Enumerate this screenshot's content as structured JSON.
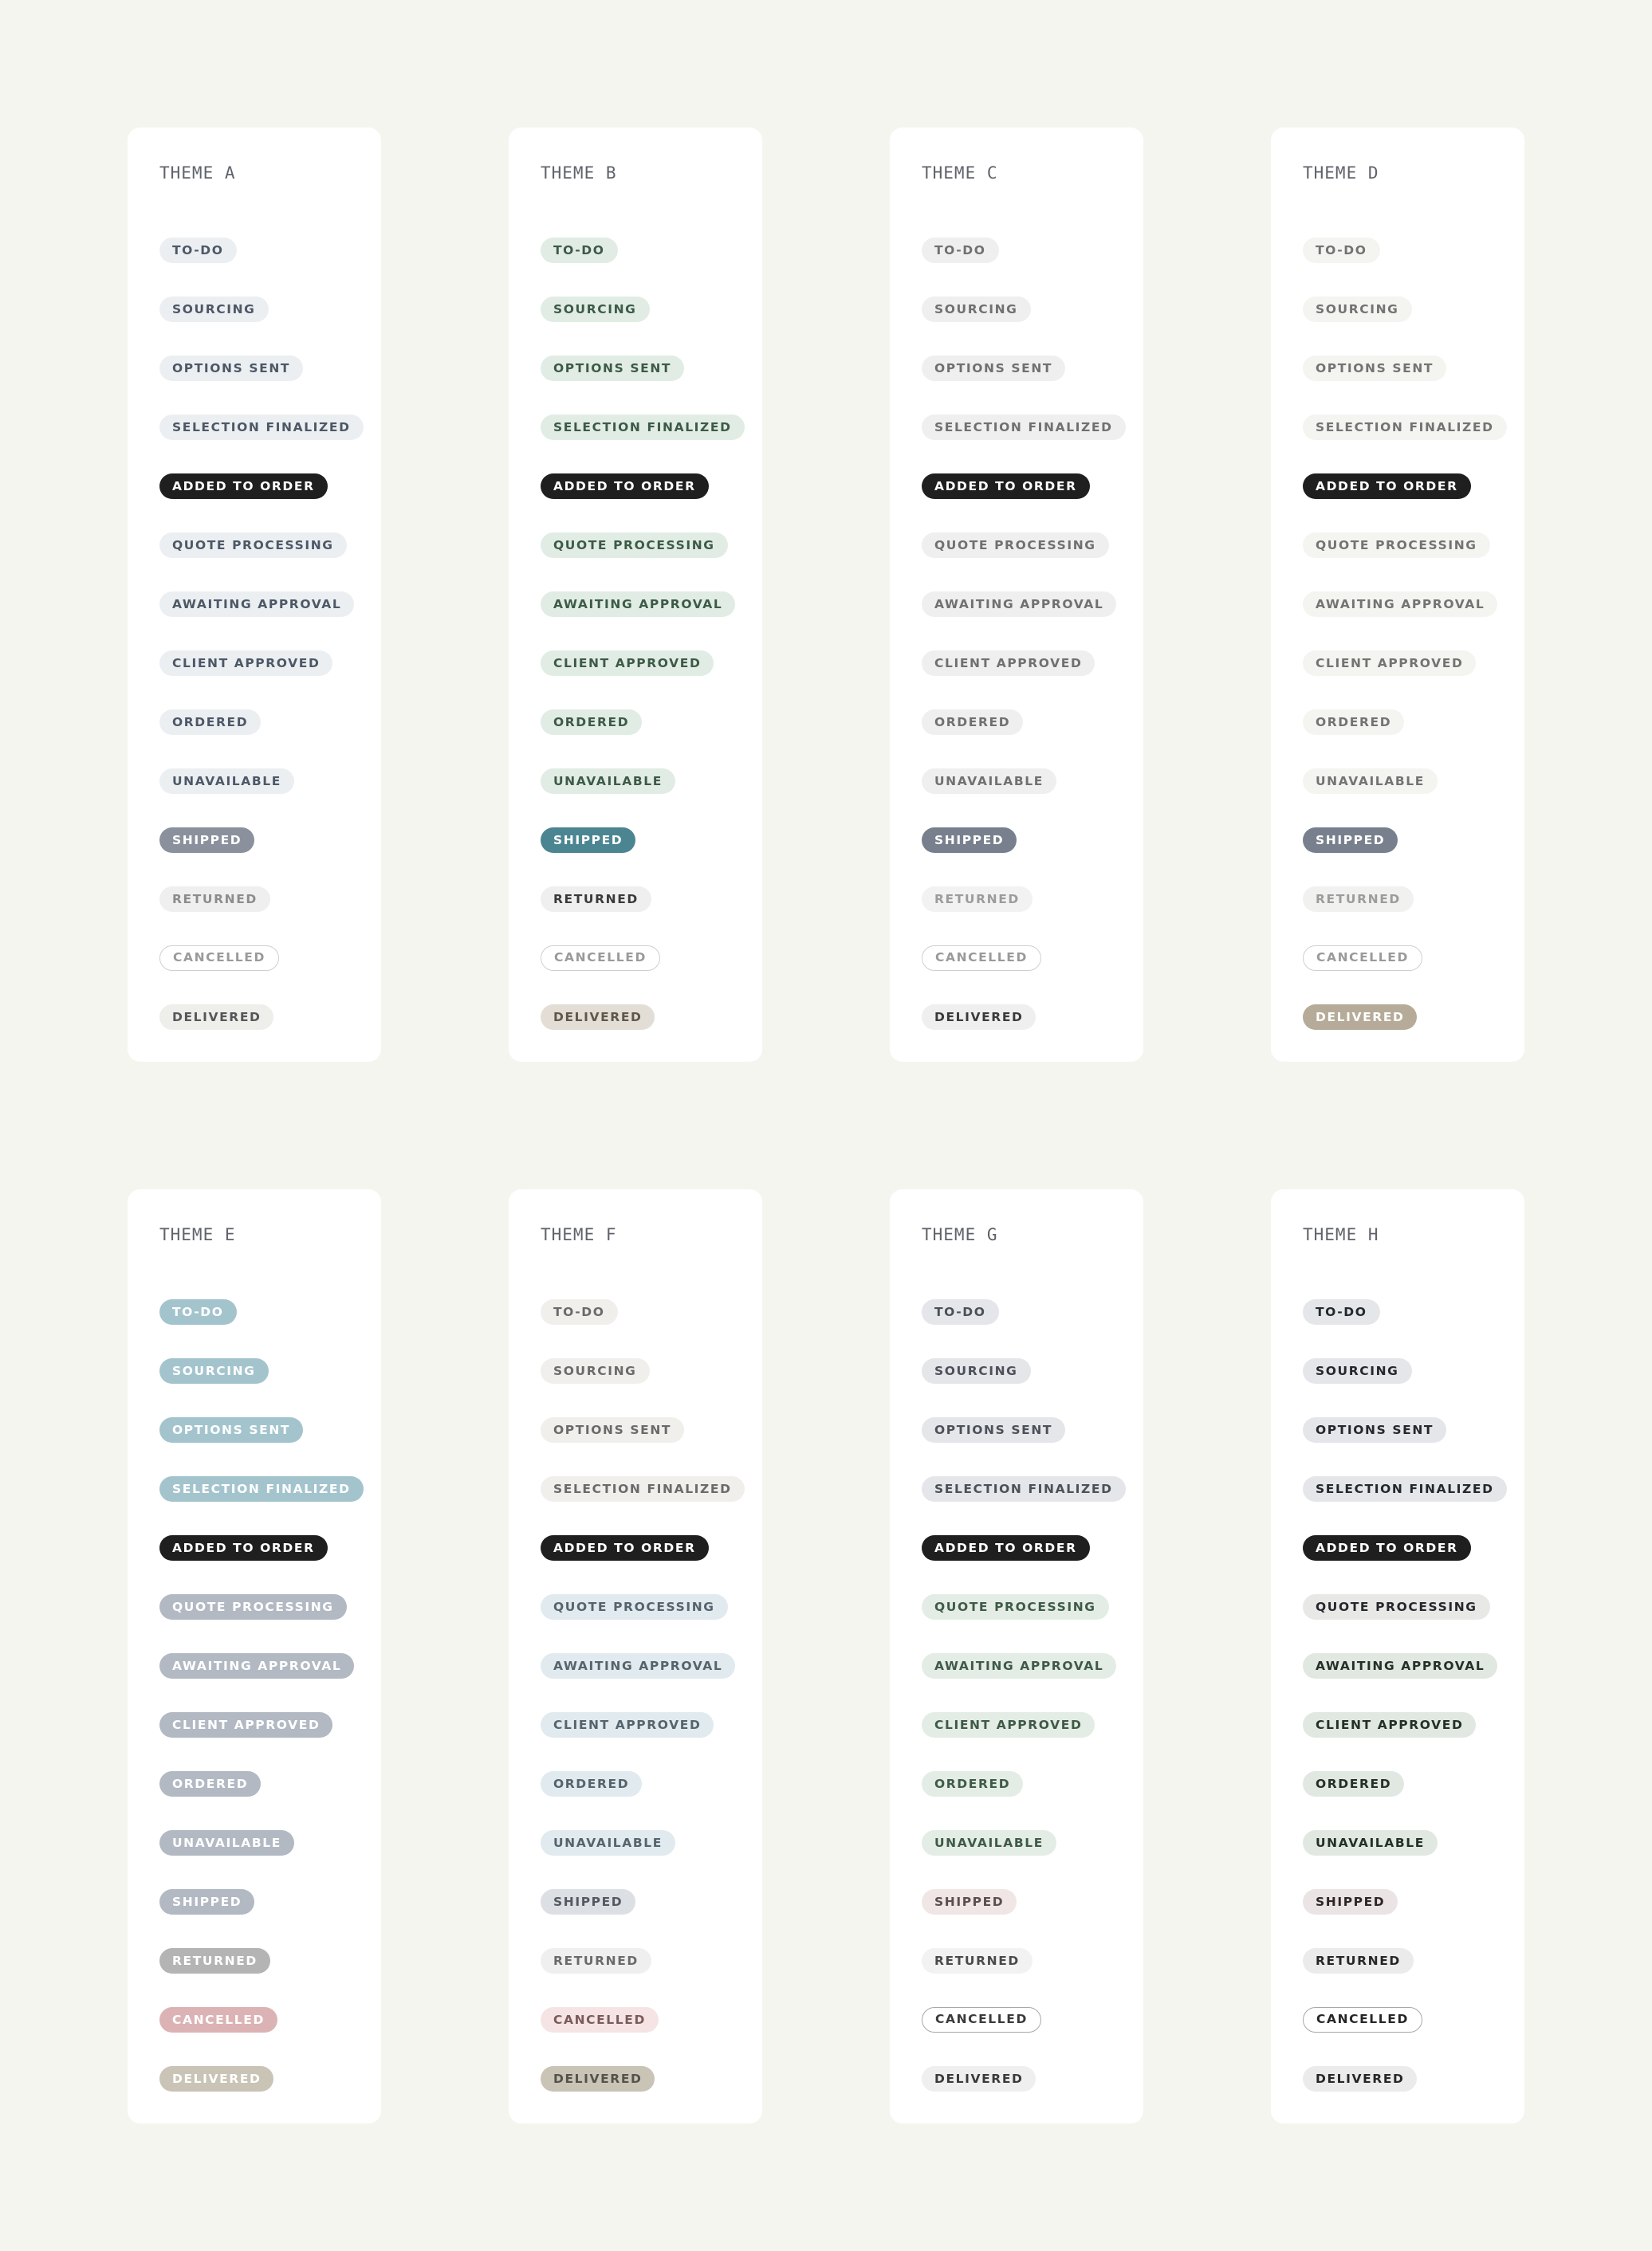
{
  "statuses": [
    "TO-DO",
    "SOURCING",
    "OPTIONS SENT",
    "SELECTION FINALIZED",
    "ADDED TO ORDER",
    "QUOTE PROCESSING",
    "AWAITING APPROVAL",
    "CLIENT APPROVED",
    "ORDERED",
    "UNAVAILABLE",
    "SHIPPED",
    "RETURNED",
    "CANCELLED",
    "DELIVERED"
  ],
  "themes": [
    {
      "title": "THEME A",
      "styles": [
        {
          "bg": "#eceff2",
          "color": "#4d5866",
          "border": "none"
        },
        {
          "bg": "#eceff2",
          "color": "#4d5866",
          "border": "none"
        },
        {
          "bg": "#eceff2",
          "color": "#4d5866",
          "border": "none"
        },
        {
          "bg": "#eceff2",
          "color": "#4d5866",
          "border": "none"
        },
        {
          "bg": "#1f1f1f",
          "color": "#ffffff",
          "border": "none"
        },
        {
          "bg": "#eceff2",
          "color": "#4d5866",
          "border": "none"
        },
        {
          "bg": "#eceff2",
          "color": "#4d5866",
          "border": "none"
        },
        {
          "bg": "#eceff2",
          "color": "#4d5866",
          "border": "none"
        },
        {
          "bg": "#eceff2",
          "color": "#4d5866",
          "border": "none"
        },
        {
          "bg": "#eceff2",
          "color": "#4d5866",
          "border": "none"
        },
        {
          "bg": "#8a919d",
          "color": "#ffffff",
          "border": "none"
        },
        {
          "bg": "#efefef",
          "color": "#8c8c8c",
          "border": "none"
        },
        {
          "bg": "#ffffff",
          "color": "#9a9a9a",
          "border": "1.5px solid #cfcfcf"
        },
        {
          "bg": "#eeeeea",
          "color": "#55555a",
          "border": "none"
        }
      ]
    },
    {
      "title": "THEME B",
      "styles": [
        {
          "bg": "#e1ede4",
          "color": "#3d5a47",
          "border": "none"
        },
        {
          "bg": "#e1ede4",
          "color": "#3d5a47",
          "border": "none"
        },
        {
          "bg": "#e1ede4",
          "color": "#3d5a47",
          "border": "none"
        },
        {
          "bg": "#e1ede4",
          "color": "#3d5a47",
          "border": "none"
        },
        {
          "bg": "#1f1f1f",
          "color": "#ffffff",
          "border": "none"
        },
        {
          "bg": "#e1ede4",
          "color": "#3d5a47",
          "border": "none"
        },
        {
          "bg": "#e1ede4",
          "color": "#3d5a47",
          "border": "none"
        },
        {
          "bg": "#e1ede4",
          "color": "#3d5a47",
          "border": "none"
        },
        {
          "bg": "#e1ede4",
          "color": "#3d5a47",
          "border": "none"
        },
        {
          "bg": "#e1ede4",
          "color": "#3d5a47",
          "border": "none"
        },
        {
          "bg": "#4c8592",
          "color": "#ffffff",
          "border": "none"
        },
        {
          "bg": "#efefef",
          "color": "#3a3a3a",
          "border": "none"
        },
        {
          "bg": "#ffffff",
          "color": "#9a9a9a",
          "border": "1.5px solid #cfcfcf"
        },
        {
          "bg": "#e2ded6",
          "color": "#5f574a",
          "border": "none"
        }
      ]
    },
    {
      "title": "THEME C",
      "styles": [
        {
          "bg": "#efefef",
          "color": "#707070",
          "border": "none"
        },
        {
          "bg": "#efefef",
          "color": "#707070",
          "border": "none"
        },
        {
          "bg": "#efefef",
          "color": "#707070",
          "border": "none"
        },
        {
          "bg": "#efefef",
          "color": "#707070",
          "border": "none"
        },
        {
          "bg": "#1f1f1f",
          "color": "#ffffff",
          "border": "none"
        },
        {
          "bg": "#efefef",
          "color": "#707070",
          "border": "none"
        },
        {
          "bg": "#efefef",
          "color": "#707070",
          "border": "none"
        },
        {
          "bg": "#efefef",
          "color": "#707070",
          "border": "none"
        },
        {
          "bg": "#efefef",
          "color": "#707070",
          "border": "none"
        },
        {
          "bg": "#efefef",
          "color": "#707070",
          "border": "none"
        },
        {
          "bg": "#79808d",
          "color": "#ffffff",
          "border": "none"
        },
        {
          "bg": "#f2f2f2",
          "color": "#9c9c9c",
          "border": "none"
        },
        {
          "bg": "#ffffff",
          "color": "#9a9a9a",
          "border": "1.5px solid #cfcfcf"
        },
        {
          "bg": "#efefef",
          "color": "#3a3a3a",
          "border": "none"
        }
      ]
    },
    {
      "title": "THEME D",
      "styles": [
        {
          "bg": "#f4f4f1",
          "color": "#737373",
          "border": "none"
        },
        {
          "bg": "#f4f4f1",
          "color": "#737373",
          "border": "none"
        },
        {
          "bg": "#f4f4f1",
          "color": "#737373",
          "border": "none"
        },
        {
          "bg": "#f4f4f1",
          "color": "#737373",
          "border": "none"
        },
        {
          "bg": "#1f1f1f",
          "color": "#ffffff",
          "border": "none"
        },
        {
          "bg": "#f4f4f1",
          "color": "#737373",
          "border": "none"
        },
        {
          "bg": "#f4f4f1",
          "color": "#737373",
          "border": "none"
        },
        {
          "bg": "#f4f4f1",
          "color": "#737373",
          "border": "none"
        },
        {
          "bg": "#f4f4f1",
          "color": "#737373",
          "border": "none"
        },
        {
          "bg": "#f4f4f1",
          "color": "#737373",
          "border": "none"
        },
        {
          "bg": "#79808d",
          "color": "#ffffff",
          "border": "none"
        },
        {
          "bg": "#f1f1ef",
          "color": "#9c9c9c",
          "border": "none"
        },
        {
          "bg": "#ffffff",
          "color": "#9a9a9a",
          "border": "1.5px solid #cfcfcf"
        },
        {
          "bg": "#b5ab98",
          "color": "#ffffff",
          "border": "none"
        }
      ]
    },
    {
      "title": "THEME E",
      "styles": [
        {
          "bg": "#a3c4cd",
          "color": "#ffffff",
          "border": "none"
        },
        {
          "bg": "#a3c4cd",
          "color": "#ffffff",
          "border": "none"
        },
        {
          "bg": "#a3c4cd",
          "color": "#ffffff",
          "border": "none"
        },
        {
          "bg": "#a3c4cd",
          "color": "#ffffff",
          "border": "none"
        },
        {
          "bg": "#1f1f1f",
          "color": "#ffffff",
          "border": "none"
        },
        {
          "bg": "#b2b9c3",
          "color": "#ffffff",
          "border": "none"
        },
        {
          "bg": "#b2b9c3",
          "color": "#ffffff",
          "border": "none"
        },
        {
          "bg": "#b2b9c3",
          "color": "#ffffff",
          "border": "none"
        },
        {
          "bg": "#b2b9c3",
          "color": "#ffffff",
          "border": "none"
        },
        {
          "bg": "#b2b9c3",
          "color": "#ffffff",
          "border": "none"
        },
        {
          "bg": "#b2b9c3",
          "color": "#ffffff",
          "border": "none"
        },
        {
          "bg": "#b4b4b4",
          "color": "#ffffff",
          "border": "none"
        },
        {
          "bg": "#dcb3b5",
          "color": "#ffffff",
          "border": "none"
        },
        {
          "bg": "#c9c4b6",
          "color": "#ffffff",
          "border": "none"
        }
      ]
    },
    {
      "title": "THEME F",
      "styles": [
        {
          "bg": "#f0efec",
          "color": "#6a6a6a",
          "border": "none"
        },
        {
          "bg": "#f0efec",
          "color": "#6a6a6a",
          "border": "none"
        },
        {
          "bg": "#f0efec",
          "color": "#6a6a6a",
          "border": "none"
        },
        {
          "bg": "#f0efec",
          "color": "#6a6a6a",
          "border": "none"
        },
        {
          "bg": "#1f1f1f",
          "color": "#ffffff",
          "border": "none"
        },
        {
          "bg": "#e1eaee",
          "color": "#55636c",
          "border": "none"
        },
        {
          "bg": "#e1eaee",
          "color": "#55636c",
          "border": "none"
        },
        {
          "bg": "#e1eaee",
          "color": "#55636c",
          "border": "none"
        },
        {
          "bg": "#e1eaee",
          "color": "#55636c",
          "border": "none"
        },
        {
          "bg": "#e1eaee",
          "color": "#55636c",
          "border": "none"
        },
        {
          "bg": "#dcdfe3",
          "color": "#55595f",
          "border": "none"
        },
        {
          "bg": "#efefef",
          "color": "#6a6a6a",
          "border": "none"
        },
        {
          "bg": "#f6e4e4",
          "color": "#7a5a5b",
          "border": "none"
        },
        {
          "bg": "#c9c4b6",
          "color": "#55524a",
          "border": "none"
        }
      ]
    },
    {
      "title": "THEME G",
      "styles": [
        {
          "bg": "#e4e6ea",
          "color": "#4c5058",
          "border": "none"
        },
        {
          "bg": "#e4e6ea",
          "color": "#4c5058",
          "border": "none"
        },
        {
          "bg": "#e4e6ea",
          "color": "#4c5058",
          "border": "none"
        },
        {
          "bg": "#e4e6ea",
          "color": "#4c5058",
          "border": "none"
        },
        {
          "bg": "#1f1f1f",
          "color": "#ffffff",
          "border": "none"
        },
        {
          "bg": "#e3ede5",
          "color": "#3f5a47",
          "border": "none"
        },
        {
          "bg": "#e3ede5",
          "color": "#3f5a47",
          "border": "none"
        },
        {
          "bg": "#e3ede5",
          "color": "#3f5a47",
          "border": "none"
        },
        {
          "bg": "#e3ede5",
          "color": "#3f5a47",
          "border": "none"
        },
        {
          "bg": "#e3ede5",
          "color": "#3f5a47",
          "border": "none"
        },
        {
          "bg": "#f1e6e6",
          "color": "#5c4e4f",
          "border": "none"
        },
        {
          "bg": "#f2f2f2",
          "color": "#4a4a4a",
          "border": "none"
        },
        {
          "bg": "#ffffff",
          "color": "#3a3a3a",
          "border": "1.5px solid #a8a8a8"
        },
        {
          "bg": "#efefef",
          "color": "#3a3a3a",
          "border": "none"
        }
      ]
    },
    {
      "title": "THEME H",
      "styles": [
        {
          "bg": "#e4e6ea",
          "color": "#24272c",
          "border": "none"
        },
        {
          "bg": "#e4e6ea",
          "color": "#24272c",
          "border": "none"
        },
        {
          "bg": "#e4e6ea",
          "color": "#24272c",
          "border": "none"
        },
        {
          "bg": "#e4e6ea",
          "color": "#24272c",
          "border": "none"
        },
        {
          "bg": "#1f1f1f",
          "color": "#ffffff",
          "border": "none"
        },
        {
          "bg": "#e8e8e6",
          "color": "#24272c",
          "border": "none"
        },
        {
          "bg": "#e1e8e1",
          "color": "#243027",
          "border": "none"
        },
        {
          "bg": "#e1e8e1",
          "color": "#243027",
          "border": "none"
        },
        {
          "bg": "#e1e8e1",
          "color": "#243027",
          "border": "none"
        },
        {
          "bg": "#e1e8e1",
          "color": "#243027",
          "border": "none"
        },
        {
          "bg": "#ebe4e4",
          "color": "#2c2626",
          "border": "none"
        },
        {
          "bg": "#ebebeb",
          "color": "#262626",
          "border": "none"
        },
        {
          "bg": "#ffffff",
          "color": "#262626",
          "border": "1.5px solid #a8a8a8"
        },
        {
          "bg": "#ebebeb",
          "color": "#262626",
          "border": "none"
        }
      ]
    }
  ]
}
